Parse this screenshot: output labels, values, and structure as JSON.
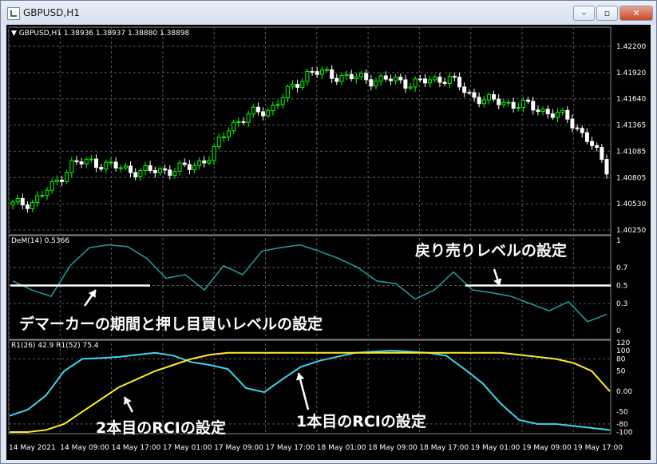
{
  "window": {
    "title": "GBPUSD,H1",
    "minimize": "–",
    "restore": "▫",
    "close": "✕"
  },
  "main": {
    "header": "GBPUSD,H1  1.38936 1.38937 1.38880 1.38898",
    "price_ticks": [
      "1.42200",
      "1.41920",
      "1.41640",
      "1.41365",
      "1.41085",
      "1.40805",
      "1.40530",
      "1.40250"
    ]
  },
  "dem": {
    "label": "DeM(14) 0.5366",
    "ticks": [
      "1",
      "0.7",
      "0.5",
      "0.3",
      "0"
    ],
    "annotation_left": "デマーカーの期間と押し目買いレベルの設定",
    "annotation_right": "戻り売りレベルの設定"
  },
  "rci": {
    "label": "R1(26) 42.9  R1(52) 75.4",
    "ticks": [
      "120",
      "100",
      "80",
      "50",
      "0.00",
      "-50",
      "-80",
      "-100"
    ],
    "annotation_slow": "2本目のRCIの設定",
    "annotation_fast": "1本目のRCIの設定"
  },
  "time_axis": [
    "14 May 2021",
    "14 May 09:00",
    "14 May 17:00",
    "17 May 01:00",
    "17 May 09:00",
    "17 May 17:00",
    "18 May 01:00",
    "18 May 09:00",
    "18 May 17:00",
    "19 May 01:00",
    "19 May 09:00",
    "19 May 17:00"
  ],
  "colors": {
    "bull": "#00ff00",
    "bear": "#ffffff",
    "dem_line": "#20a0a0",
    "rci_fast": "#3cd4f0",
    "rci_slow": "#ffee22",
    "level_line": "#ffffff"
  },
  "chart_data": [
    {
      "type": "line",
      "title": "GBPUSD,H1 candlestick",
      "x": [
        0,
        4,
        8,
        12,
        16,
        20,
        24,
        28,
        32,
        36,
        40,
        44,
        48,
        52,
        56,
        60,
        64,
        68,
        72,
        76,
        80,
        84,
        88,
        92,
        96,
        100,
        104,
        108,
        112,
        116,
        120
      ],
      "series": [
        {
          "name": "close",
          "values": [
            1.4049,
            1.4052,
            1.407,
            1.4096,
            1.4098,
            1.4093,
            1.4088,
            1.4087,
            1.4089,
            1.4092,
            1.4105,
            1.414,
            1.4152,
            1.4158,
            1.418,
            1.4202,
            1.4197,
            1.4195,
            1.4192,
            1.4192,
            1.4188,
            1.419,
            1.4195,
            1.4175,
            1.4168,
            1.4165,
            1.4162,
            1.4155,
            1.4148,
            1.4125,
            1.409
          ]
        }
      ],
      "ylim": [
        1.402,
        1.423
      ]
    },
    {
      "type": "line",
      "title": "DeM(14) 0.5366",
      "series": [
        {
          "name": "DeM(14)",
          "values": [
            0.55,
            0.45,
            0.38,
            0.72,
            0.92,
            0.95,
            0.93,
            0.8,
            0.58,
            0.62,
            0.45,
            0.72,
            0.62,
            0.88,
            0.92,
            0.95,
            0.88,
            0.8,
            0.7,
            0.55,
            0.52,
            0.35,
            0.45,
            0.65,
            0.45,
            0.42,
            0.38,
            0.3,
            0.22,
            0.32,
            0.1,
            0.18
          ]
        }
      ],
      "levels": [
        0.5
      ],
      "ylim": [
        0,
        1
      ]
    },
    {
      "type": "line",
      "title": "R1(26) 42.9  R1(52) 75.4",
      "series": [
        {
          "name": "R1(26)",
          "values": [
            -60,
            -45,
            -10,
            50,
            80,
            82,
            85,
            90,
            95,
            88,
            72,
            65,
            55,
            8,
            -2,
            30,
            60,
            75,
            85,
            95,
            98,
            100,
            98,
            95,
            88,
            55,
            20,
            -30,
            -70,
            -80,
            -80,
            -85,
            -90,
            -95
          ]
        },
        {
          "name": "R1(52)",
          "values": [
            -100,
            -100,
            -95,
            -80,
            -50,
            -20,
            10,
            30,
            50,
            65,
            80,
            90,
            95,
            95,
            95,
            95,
            95,
            95,
            95,
            95,
            95,
            95,
            95,
            95,
            95,
            95,
            95,
            95,
            90,
            85,
            80,
            70,
            50,
            0
          ]
        }
      ],
      "ylim": [
        -100,
        120
      ]
    }
  ]
}
